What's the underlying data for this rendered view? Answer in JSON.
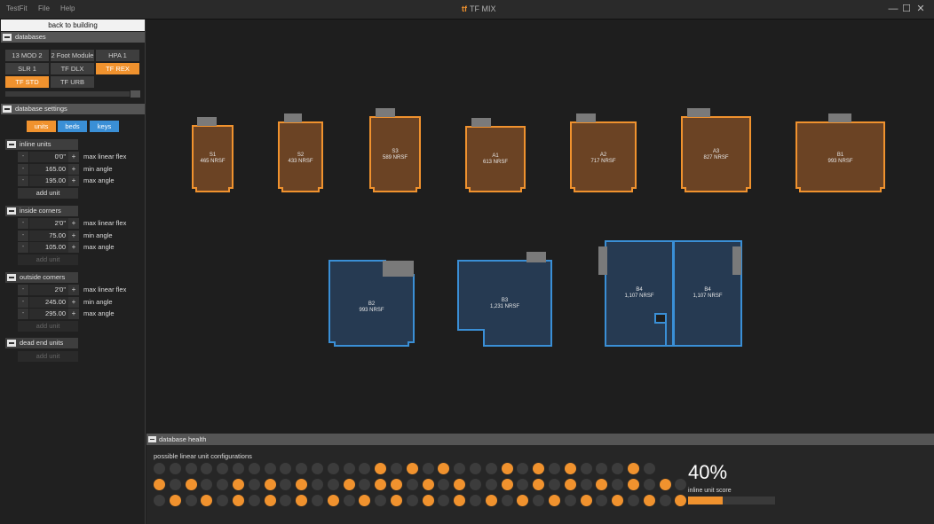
{
  "window": {
    "menu": [
      "TestFit",
      "File",
      "Help"
    ],
    "title": "TF MIX",
    "logo": "tf",
    "controls": [
      "minimize-icon",
      "maximize-icon",
      "close-icon"
    ]
  },
  "left_panel": {
    "back_button": "back to building",
    "databases_header": "databases",
    "databases": [
      {
        "label": "13 MOD 2",
        "active": false
      },
      {
        "label": "2 Foot Module",
        "active": false
      },
      {
        "label": "HPA 1",
        "active": false
      },
      {
        "label": "SLR 1",
        "active": false
      },
      {
        "label": "TF DLX",
        "active": false
      },
      {
        "label": "TF REX",
        "active": true
      },
      {
        "label": "TF STD",
        "active": true
      },
      {
        "label": "TF URB",
        "active": false
      }
    ],
    "settings_header": "database settings",
    "tabs": [
      {
        "label": "units",
        "color": "#f0922e"
      },
      {
        "label": "beds",
        "color": "#3a8fd6"
      },
      {
        "label": "keys",
        "color": "#3a8fd6"
      }
    ],
    "groups": [
      {
        "title": "inline units",
        "rows": [
          {
            "value": "0'0\"",
            "label": "max linear flex"
          },
          {
            "value": "165.00",
            "label": "min angle"
          },
          {
            "value": "195.00",
            "label": "max angle"
          }
        ],
        "add_label": "add unit",
        "add_enabled": true
      },
      {
        "title": "inside corners",
        "rows": [
          {
            "value": "2'0\"",
            "label": "max linear flex"
          },
          {
            "value": "75.00",
            "label": "min angle"
          },
          {
            "value": "105.00",
            "label": "max angle"
          }
        ],
        "add_label": "add unit",
        "add_enabled": false
      },
      {
        "title": "outside corners",
        "rows": [
          {
            "value": "2'0\"",
            "label": "max linear flex"
          },
          {
            "value": "245.00",
            "label": "min angle"
          },
          {
            "value": "295.00",
            "label": "max angle"
          }
        ],
        "add_label": "add unit",
        "add_enabled": false
      },
      {
        "title": "dead end units",
        "rows": [],
        "add_label": "add unit",
        "add_enabled": false
      }
    ]
  },
  "canvas": {
    "units": [
      {
        "id": "S1",
        "area": "465 NRSF",
        "type": "orange"
      },
      {
        "id": "S2",
        "area": "433 NRSF",
        "type": "orange"
      },
      {
        "id": "S3",
        "area": "589 NRSF",
        "type": "orange"
      },
      {
        "id": "A1",
        "area": "613 NRSF",
        "type": "orange"
      },
      {
        "id": "A2",
        "area": "717 NRSF",
        "type": "orange"
      },
      {
        "id": "A3",
        "area": "827 NRSF",
        "type": "orange"
      },
      {
        "id": "B1",
        "area": "993 NRSF",
        "type": "orange"
      },
      {
        "id": "B2",
        "area": "993 NRSF",
        "type": "blue"
      },
      {
        "id": "B3",
        "area": "1,231 NRSF",
        "type": "blue"
      },
      {
        "id": "B4",
        "area": "1,107 NRSF",
        "type": "blue"
      },
      {
        "id": "B4",
        "area": "1,107 NRSF",
        "type": "blue"
      }
    ],
    "colors": {
      "orange_fill": "#6b4324",
      "orange_stroke": "#f0922e",
      "blue_fill": "#263a52",
      "blue_stroke": "#3a8fd6",
      "door": "#7a7a7a"
    }
  },
  "health": {
    "header": "database health",
    "configs_label": "possible linear unit configurations",
    "score_value": "40%",
    "score_label": "inline unit score",
    "score_fraction": 0.4,
    "rows": [
      [
        0,
        0,
        0,
        0,
        0,
        0,
        0,
        0,
        0,
        0,
        0,
        0,
        0,
        0,
        1,
        0,
        1,
        0,
        1,
        0,
        0,
        0,
        1,
        0,
        1,
        0,
        1,
        0,
        0,
        0,
        1,
        0
      ],
      [
        1,
        0,
        1,
        0,
        0,
        1,
        0,
        1,
        0,
        1,
        0,
        0,
        1,
        0,
        1,
        1,
        0,
        1,
        0,
        1,
        0,
        0,
        1,
        0,
        1,
        0,
        1,
        0,
        1,
        0,
        1,
        0,
        1,
        0
      ],
      [
        0,
        1,
        0,
        1,
        0,
        1,
        0,
        1,
        0,
        1,
        0,
        1,
        0,
        1,
        0,
        1,
        0,
        1,
        0,
        1,
        0,
        1,
        0,
        1,
        0,
        1,
        0,
        1,
        0,
        1,
        0,
        1,
        0,
        1
      ]
    ]
  }
}
